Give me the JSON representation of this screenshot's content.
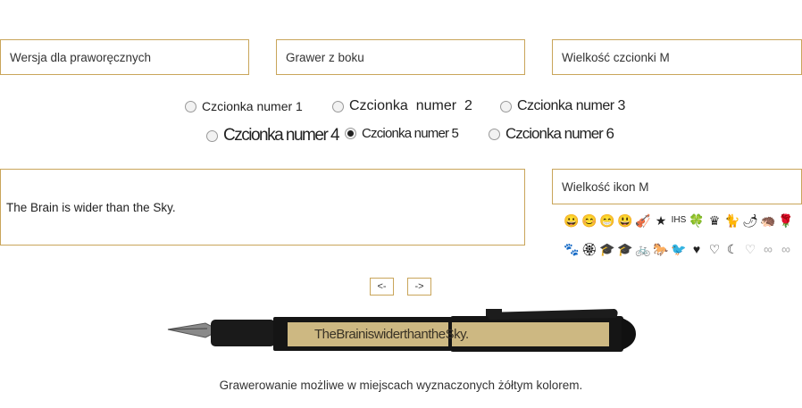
{
  "selects": {
    "hand_version": "Wersja dla praworęcznych",
    "engrave_position": "Grawer z boku",
    "font_size": "Wielkość czcionki M",
    "icon_size": "Wielkość ikon M"
  },
  "fonts": [
    {
      "label": "Czcionka numer 1",
      "checked": false
    },
    {
      "label": "Czcionka  numer  2",
      "checked": false
    },
    {
      "label": "Czcionka numer 3",
      "checked": false
    },
    {
      "label": "Czcionka numer 4",
      "checked": false
    },
    {
      "label": "Czcionka numer 5",
      "checked": true
    },
    {
      "label": "Czcionka numer 6",
      "checked": false
    }
  ],
  "engraving_text": "The Brain is wider than the Sky.",
  "icons": {
    "row1": [
      "😀",
      "😊",
      "😁",
      "😃",
      "🎻",
      "★",
      "IHS",
      "🍀",
      "♛",
      "🐈",
      "🌶",
      "🦔",
      "🌹"
    ],
    "row2": [
      "🐾",
      "🏵",
      "🎓",
      "🎓",
      "🚲",
      "🐎",
      "🐦",
      "♥",
      "♡",
      "☾",
      "♡",
      "∞",
      "∞"
    ]
  },
  "nav": {
    "prev": "<-",
    "next": "->"
  },
  "pen_engraving": "TheBrainiswiderthantheSky.",
  "caption": "Grawerowanie możliwe w miejscach wyznaczonych żółtym kolorem.",
  "colors": {
    "accent": "#c9a55a",
    "engraving_area": "#cdb882"
  }
}
